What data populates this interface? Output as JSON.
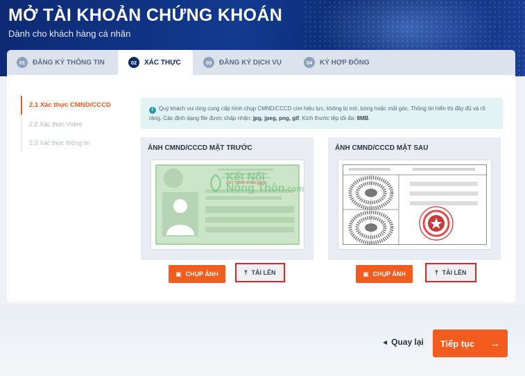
{
  "header": {
    "title": "MỞ TÀI KHOẢN CHỨNG KHOÁN",
    "subtitle": "Dành cho khách hàng cá nhân"
  },
  "tabs": [
    {
      "num": "01",
      "label": "ĐĂNG KÝ THÔNG TIN"
    },
    {
      "num": "02",
      "label": "XÁC THỰC"
    },
    {
      "num": "03",
      "label": "ĐĂNG KÝ DỊCH VỤ"
    },
    {
      "num": "04",
      "label": "KÝ HỢP ĐỒNG"
    }
  ],
  "steps": [
    {
      "label": "2.1  Xác thực CMND/CCCD"
    },
    {
      "label": "2.2  Xác thực Video"
    },
    {
      "label": "2.3  Xác thực thông tin"
    }
  ],
  "notice": {
    "text_1": "Quý khách vui lòng cung cấp hình chụp CMND/CCCD còn hiệu lực, không bị mờ, bóng hoặc mất góc. Thông tin hiển thị đầy đủ và rõ ràng. Các định dạng file được chấp nhận: ",
    "formats": "jpg, jpeg, png, gif",
    "text_2": ". Kích thước tệp tối đa: ",
    "max_size": "8MB",
    "text_3": "."
  },
  "front": {
    "title": "ẢNH CMND/CCCD MẶT TRƯỚC",
    "card_stamp": "QUY TRÌNH NHẬN DẠNG",
    "capture_label": "CHỤP ẢNH",
    "upload_label": "TẢI LÊN"
  },
  "back": {
    "title": "ẢNH CMND/CCCD MẶT SAU",
    "capture_label": "CHỤP ẢNH",
    "upload_label": "TẢI LÊN"
  },
  "watermark": {
    "line1": "Kết Nối",
    "line2": "Nông Thôn",
    "suffix": ".com"
  },
  "footer": {
    "back_label": "Quay lại",
    "next_label": "Tiếp tục"
  },
  "colors": {
    "brand_navy": "#0c2b6b",
    "accent_orange": "#f25c1f",
    "highlight_red": "#d9262b"
  }
}
